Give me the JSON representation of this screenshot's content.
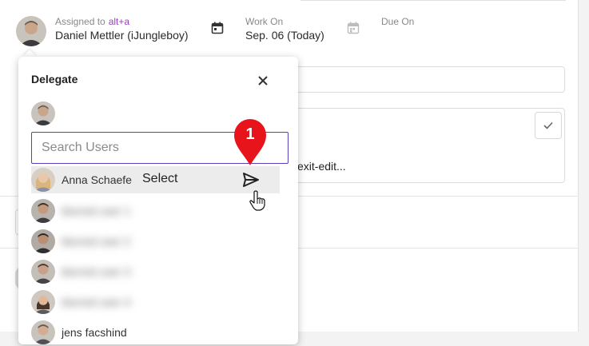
{
  "assignment": {
    "assigned_label": "Assigned to",
    "shortcut": "alt+a",
    "assignee_name": "Daniel Mettler (iJungleboy)"
  },
  "work_on": {
    "label": "Work On",
    "value": "Sep. 06 (Today)"
  },
  "due_on": {
    "label": "Due On"
  },
  "background": {
    "exit_edit_text": "exit-edit..."
  },
  "delegate": {
    "title": "Delegate",
    "search_placeholder": "Search Users",
    "highlighted_user": "Anna Schaefe",
    "select_label": "Select",
    "users": [
      {
        "name": "blurred user 1"
      },
      {
        "name": "blurred user 2"
      },
      {
        "name": "blurred user 3"
      },
      {
        "name": "blurred user 4"
      },
      {
        "name": "jens facshind"
      }
    ]
  },
  "annotation": {
    "step_number": "1"
  },
  "colors": {
    "accent": "#9b3ec6",
    "focus_border": "#5a3fb5",
    "pin_red": "#e8141c"
  }
}
